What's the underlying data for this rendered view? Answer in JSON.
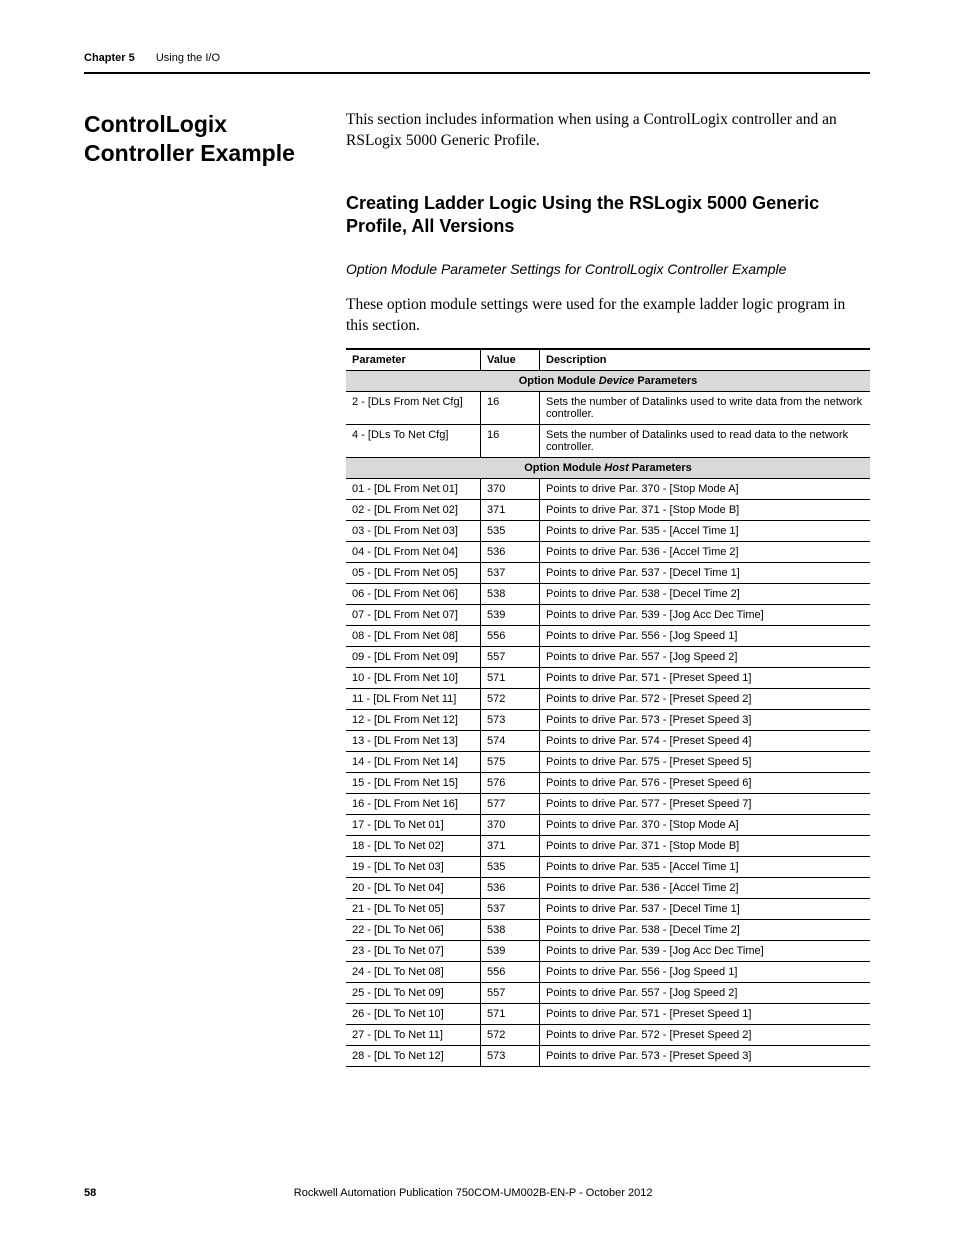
{
  "header": {
    "chapter": "Chapter 5",
    "title": "Using the I/O"
  },
  "section_title": "ControlLogix Controller Example",
  "intro": "This section includes information when using a ControlLogix controller and an RSLogix 5000 Generic Profile.",
  "h2": "Creating Ladder Logic Using the RSLogix 5000 Generic Profile, All Versions",
  "h3": "Option Module Parameter Settings for ControlLogix Controller Example",
  "lead_para": "These option module settings were used for the example ladder logic program in this section.",
  "table": {
    "headers": {
      "param": "Parameter",
      "value": "Value",
      "desc": "Description"
    },
    "section1_prefix": "Option Module ",
    "section1_em": "Device",
    "section1_suffix": " Parameters",
    "device_rows": [
      {
        "param": "2 - [DLs From Net Cfg]",
        "value": "16",
        "desc": "Sets the number of Datalinks used to write data from the network controller."
      },
      {
        "param": "4 - [DLs To Net Cfg]",
        "value": "16",
        "desc": "Sets the number of Datalinks used to read data to the network controller."
      }
    ],
    "section2_prefix": "Option Module ",
    "section2_em": "Host",
    "section2_suffix": " Parameters",
    "host_rows": [
      {
        "param": "01 - [DL From Net 01]",
        "value": "370",
        "desc": "Points to drive Par. 370 - [Stop Mode A]"
      },
      {
        "param": "02 - [DL From Net 02]",
        "value": "371",
        "desc": "Points to drive Par. 371 - [Stop Mode B]"
      },
      {
        "param": "03 - [DL From Net 03]",
        "value": "535",
        "desc": "Points to drive Par. 535 - [Accel Time 1]"
      },
      {
        "param": "04 - [DL From Net 04]",
        "value": "536",
        "desc": "Points to drive Par. 536 - [Accel Time 2]"
      },
      {
        "param": "05 - [DL From Net 05]",
        "value": "537",
        "desc": "Points to drive Par. 537 - [Decel Time 1]"
      },
      {
        "param": "06 - [DL From Net 06]",
        "value": "538",
        "desc": "Points to drive Par. 538 - [Decel Time 2]"
      },
      {
        "param": "07 - [DL From Net 07]",
        "value": "539",
        "desc": "Points to drive Par. 539 - [Jog Acc Dec Time]"
      },
      {
        "param": "08 - [DL From Net 08]",
        "value": "556",
        "desc": "Points to drive Par. 556 - [Jog Speed 1]"
      },
      {
        "param": "09 - [DL From Net 09]",
        "value": "557",
        "desc": "Points to drive Par. 557 - [Jog Speed 2]"
      },
      {
        "param": "10 - [DL From Net 10]",
        "value": "571",
        "desc": "Points to drive Par. 571 - [Preset Speed 1]"
      },
      {
        "param": "11 - [DL From Net 11]",
        "value": "572",
        "desc": "Points to drive Par. 572 - [Preset Speed 2]"
      },
      {
        "param": "12 - [DL From Net 12]",
        "value": "573",
        "desc": "Points to drive Par. 573 - [Preset Speed 3]"
      },
      {
        "param": "13 - [DL From Net 13]",
        "value": "574",
        "desc": "Points to drive Par. 574 - [Preset Speed 4]"
      },
      {
        "param": "14 - [DL From Net 14]",
        "value": "575",
        "desc": "Points to drive Par. 575 - [Preset Speed 5]"
      },
      {
        "param": "15 - [DL From Net 15]",
        "value": "576",
        "desc": "Points to drive Par. 576 - [Preset Speed 6]"
      },
      {
        "param": "16 - [DL From Net 16]",
        "value": "577",
        "desc": "Points to drive Par. 577 - [Preset Speed 7]"
      },
      {
        "param": "17 - [DL To Net 01]",
        "value": "370",
        "desc": "Points to drive Par. 370 - [Stop Mode A]"
      },
      {
        "param": "18 - [DL To Net 02]",
        "value": "371",
        "desc": "Points to drive Par. 371 - [Stop Mode B]"
      },
      {
        "param": "19 - [DL To Net 03]",
        "value": "535",
        "desc": "Points to drive Par. 535 - [Accel Time 1]"
      },
      {
        "param": "20 - [DL To Net 04]",
        "value": "536",
        "desc": "Points to drive Par. 536 - [Accel Time 2]"
      },
      {
        "param": "21 - [DL To Net 05]",
        "value": "537",
        "desc": "Points to drive Par. 537 - [Decel Time 1]"
      },
      {
        "param": "22 - [DL To Net 06]",
        "value": "538",
        "desc": "Points to drive Par. 538 - [Decel Time 2]"
      },
      {
        "param": "23 - [DL To Net 07]",
        "value": "539",
        "desc": "Points to drive Par. 539 - [Jog Acc Dec Time]"
      },
      {
        "param": "24 - [DL To Net 08]",
        "value": "556",
        "desc": "Points to drive Par. 556 - [Jog Speed 1]"
      },
      {
        "param": "25 - [DL To Net 09]",
        "value": "557",
        "desc": "Points to drive Par. 557 - [Jog Speed 2]"
      },
      {
        "param": "26 - [DL To Net 10]",
        "value": "571",
        "desc": "Points to drive Par. 571 - [Preset Speed 1]"
      },
      {
        "param": "27 - [DL To Net 11]",
        "value": "572",
        "desc": "Points to drive Par. 572 - [Preset Speed 2]"
      },
      {
        "param": "28 - [DL To Net 12]",
        "value": "573",
        "desc": "Points to drive Par. 573 - [Preset Speed 3]"
      }
    ]
  },
  "footer": {
    "page_num": "58",
    "publication": "Rockwell Automation Publication 750COM-UM002B-EN-P - October 2012"
  }
}
